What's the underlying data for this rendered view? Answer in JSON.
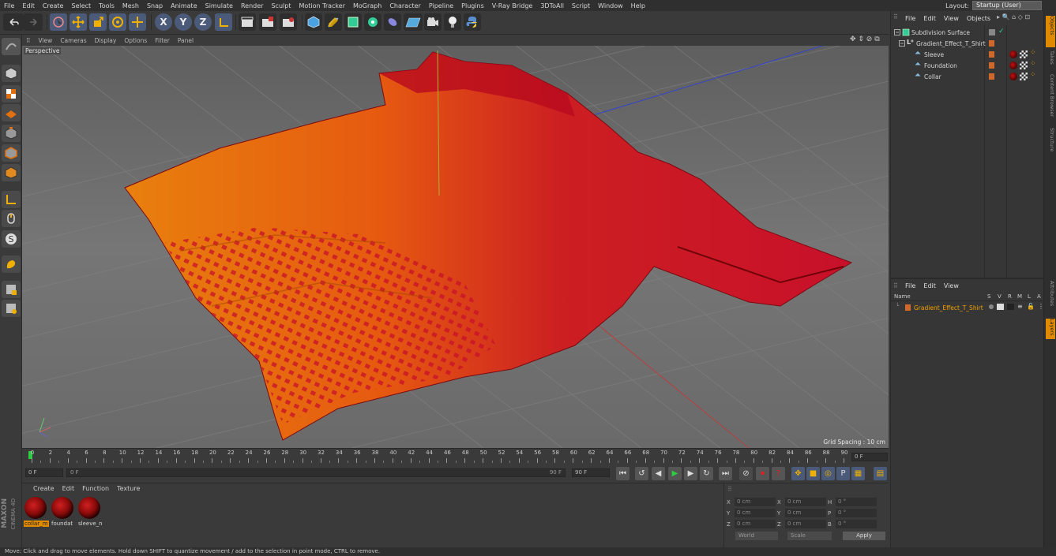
{
  "menubar": {
    "items": [
      "File",
      "Edit",
      "Create",
      "Select",
      "Tools",
      "Mesh",
      "Snap",
      "Animate",
      "Simulate",
      "Render",
      "Sculpt",
      "Motion Tracker",
      "MoGraph",
      "Character",
      "Pipeline",
      "Plugins",
      "V-Ray Bridge",
      "3DToAll",
      "Script",
      "Window",
      "Help"
    ],
    "layout_label": "Layout:",
    "layout_value": "Startup (User)"
  },
  "toolbar": {
    "axis_x": "X",
    "axis_y": "Y",
    "axis_z": "Z"
  },
  "viewport": {
    "menu": [
      "View",
      "Cameras",
      "Display",
      "Options",
      "Filter",
      "Panel"
    ],
    "camera_label": "Perspective",
    "grid_spacing": "Grid Spacing : 10 cm"
  },
  "timeline": {
    "ticks": [
      "0",
      "2",
      "4",
      "6",
      "8",
      "10",
      "12",
      "14",
      "16",
      "18",
      "20",
      "22",
      "24",
      "26",
      "28",
      "30",
      "32",
      "34",
      "36",
      "38",
      "40",
      "42",
      "44",
      "46",
      "48",
      "50",
      "52",
      "54",
      "56",
      "58",
      "60",
      "62",
      "64",
      "66",
      "68",
      "70",
      "72",
      "74",
      "76",
      "78",
      "80",
      "82",
      "84",
      "86",
      "88",
      "90"
    ],
    "current_frame": "0 F"
  },
  "transport": {
    "start_field": "0 F",
    "slider_left": "0 F",
    "slider_right": "90 F",
    "end_field": "90 F"
  },
  "material_manager": {
    "menu": [
      "Create",
      "Edit",
      "Function",
      "Texture"
    ],
    "materials": [
      {
        "name": "collar_m",
        "selected": true
      },
      {
        "name": "foundat",
        "selected": false
      },
      {
        "name": "sleeve_n",
        "selected": false
      }
    ]
  },
  "coordinates": {
    "rows": [
      {
        "l1": "X",
        "v1": "0 cm",
        "l2": "X",
        "v2": "0 cm",
        "l3": "H",
        "v3": "0 °"
      },
      {
        "l1": "Y",
        "v1": "0 cm",
        "l2": "Y",
        "v2": "0 cm",
        "l3": "P",
        "v3": "0 °"
      },
      {
        "l1": "Z",
        "v1": "0 cm",
        "l2": "Z",
        "v2": "0 cm",
        "l3": "B",
        "v3": "0 °"
      }
    ],
    "mode": "World",
    "transform": "Scale",
    "apply_label": "Apply"
  },
  "branding": {
    "line1": "MAXON",
    "line2": "CINEMA 4D"
  },
  "status": "Move: Click and drag to move elements. Hold down SHIFT to quantize movement / add to the selection in point mode, CTRL to remove.",
  "object_manager": {
    "menu": [
      "File",
      "Edit",
      "View",
      "Objects"
    ],
    "objects": [
      {
        "name": "Subdivision Surface"
      },
      {
        "name": "Gradient_Effect_T_Shirt"
      },
      {
        "name": "Sleeve"
      },
      {
        "name": "Foundation"
      },
      {
        "name": "Collar"
      }
    ]
  },
  "layer_manager": {
    "menu": [
      "File",
      "Edit",
      "View"
    ],
    "header": {
      "name": "Name",
      "cols": [
        "S",
        "V",
        "R",
        "M",
        "L",
        "A"
      ]
    },
    "layers": [
      {
        "name": "Gradient_Effect_T_Shirt"
      }
    ]
  },
  "side_tabs": [
    "Objects",
    "Takes",
    "Content Browser",
    "Structure",
    "Attributes",
    "Layers"
  ],
  "colors": {
    "accent": "#e08a00",
    "shirt_red": "#c8102a",
    "shirt_orange": "#e07010"
  }
}
